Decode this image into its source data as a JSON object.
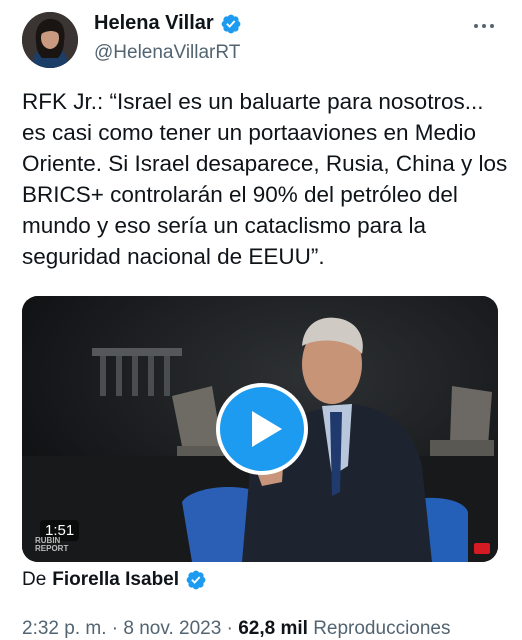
{
  "author": {
    "name": "Helena Villar",
    "handle": "@HelenaVillarRT",
    "verified": true
  },
  "tweet": {
    "text": "RFK Jr.: “Israel es un baluarte para nosotros... es casi como tener un portaaviones en Medio Oriente. Si Israel desaparece, Rusia, China y los BRICS+ controlarán el 90% del petróleo del mundo y eso sería un cataclismo para la seguridad nacional de EEUU”."
  },
  "media": {
    "duration": "1:51",
    "watermark_line1": "RUBIN",
    "watermark_line2": "REPORT"
  },
  "source": {
    "prefix": "De",
    "name": "Fiorella Isabel",
    "verified": true
  },
  "meta": {
    "time": "2:32 p. m.",
    "separator": "·",
    "date": "8 nov. 2023",
    "views": "62,8 mil",
    "views_label": "Reproducciones"
  },
  "colors": {
    "verified_blue": "#1d9bf0",
    "text_primary": "#0f1419",
    "text_secondary": "#536471"
  }
}
